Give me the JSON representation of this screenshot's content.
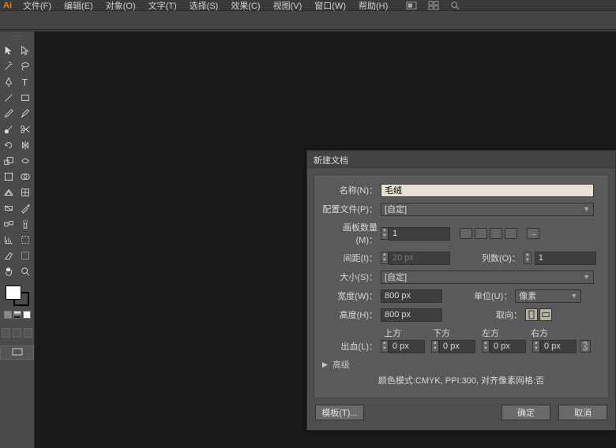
{
  "app_icon": "Ai",
  "menus": [
    "文件(F)",
    "编辑(E)",
    "对象(O)",
    "文字(T)",
    "选择(S)",
    "效果(C)",
    "视图(V)",
    "窗口(W)",
    "帮助(H)"
  ],
  "dialog": {
    "title": "新建文档",
    "fields": {
      "name_label": "名称(N)：",
      "name_value": "毛绒",
      "profile_label": "配置文件(P)：",
      "profile_value": "[自定]",
      "artboards_label": "画板数量(M)：",
      "artboards_value": "1",
      "spacing_label": "间距(I)：",
      "spacing_value": "20 px",
      "columns_label": "列数(O)：",
      "columns_value": "1",
      "size_label": "大小(S)：",
      "size_value": "[自定]",
      "width_label": "宽度(W)：",
      "width_value": "800 px",
      "units_label": "单位(U)：",
      "units_value": "像素",
      "height_label": "高度(H)：",
      "height_value": "800 px",
      "orient_label": "取向：",
      "bleed_label": "出血(L)：",
      "bleed_top_label": "上方",
      "bleed_bottom_label": "下方",
      "bleed_left_label": "左方",
      "bleed_right_label": "右方",
      "bleed_value": "0 px",
      "advanced_label": "高级",
      "summary": "颜色模式:CMYK, PPI:300, 对齐像素网格:否"
    },
    "buttons": {
      "templates": "模板(T)...",
      "ok": "确定",
      "cancel": "取消"
    }
  }
}
